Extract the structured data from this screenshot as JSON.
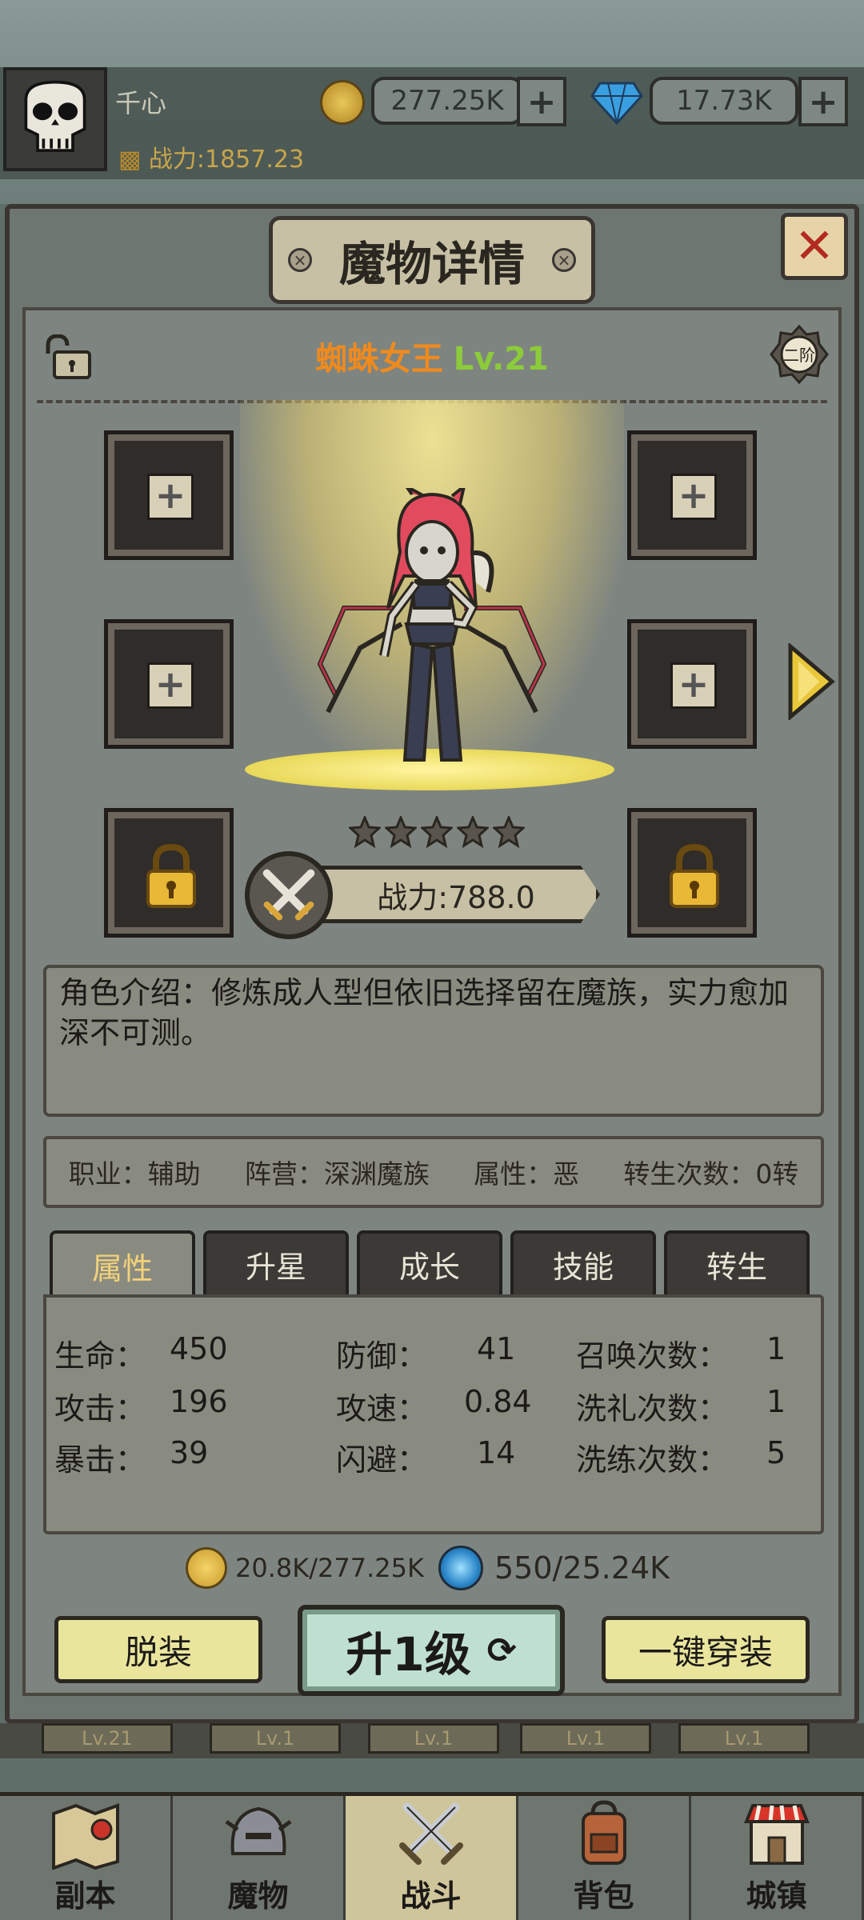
{
  "player": {
    "name": "千心",
    "power": "战力:1857.23",
    "gold": "277.25K",
    "gems": "17.73K"
  },
  "dialog": {
    "title": "魔物详情"
  },
  "monster": {
    "name": "蜘蛛女王",
    "level": "Lv.21",
    "rank": "二阶",
    "stars": 5,
    "power": "战力:788.0",
    "description": "角色介绍：修炼成人型但依旧选择留在魔族，实力愈加深不可测。",
    "info": {
      "job": "职业：辅助",
      "camp": "阵营：深渊魔族",
      "attribute": "属性：恶",
      "rebirth": "转生次数：0转"
    }
  },
  "tabs": [
    "属性",
    "升星",
    "成长",
    "技能",
    "转生"
  ],
  "active_tab": "属性",
  "stats": [
    {
      "label": "生命：",
      "value": "450"
    },
    {
      "label": "防御：",
      "value": "41"
    },
    {
      "label": "召唤次数：",
      "value": "1"
    },
    {
      "label": "攻击：",
      "value": "196"
    },
    {
      "label": "攻速：",
      "value": "0.84"
    },
    {
      "label": "洗礼次数：",
      "value": "1"
    },
    {
      "label": "暴击：",
      "value": "39"
    },
    {
      "label": "闪避：",
      "value": "14"
    },
    {
      "label": "洗练次数：",
      "value": "5"
    }
  ],
  "costs": {
    "gold": "20.8K/277.25K",
    "orb": "550/25.24K"
  },
  "buttons": {
    "unequip": "脱装",
    "level_up": "升1级",
    "equip_all": "一键穿装"
  },
  "level_chips": [
    "Lv.21",
    "Lv.1",
    "Lv.1",
    "Lv.1",
    "Lv.1"
  ],
  "nav": [
    {
      "label": "副本",
      "icon": "map-icon"
    },
    {
      "label": "魔物",
      "icon": "helmet-icon"
    },
    {
      "label": "战斗",
      "icon": "crossed-swords-icon"
    },
    {
      "label": "背包",
      "icon": "backpack-icon"
    },
    {
      "label": "城镇",
      "icon": "shop-icon"
    }
  ],
  "active_nav": "战斗"
}
